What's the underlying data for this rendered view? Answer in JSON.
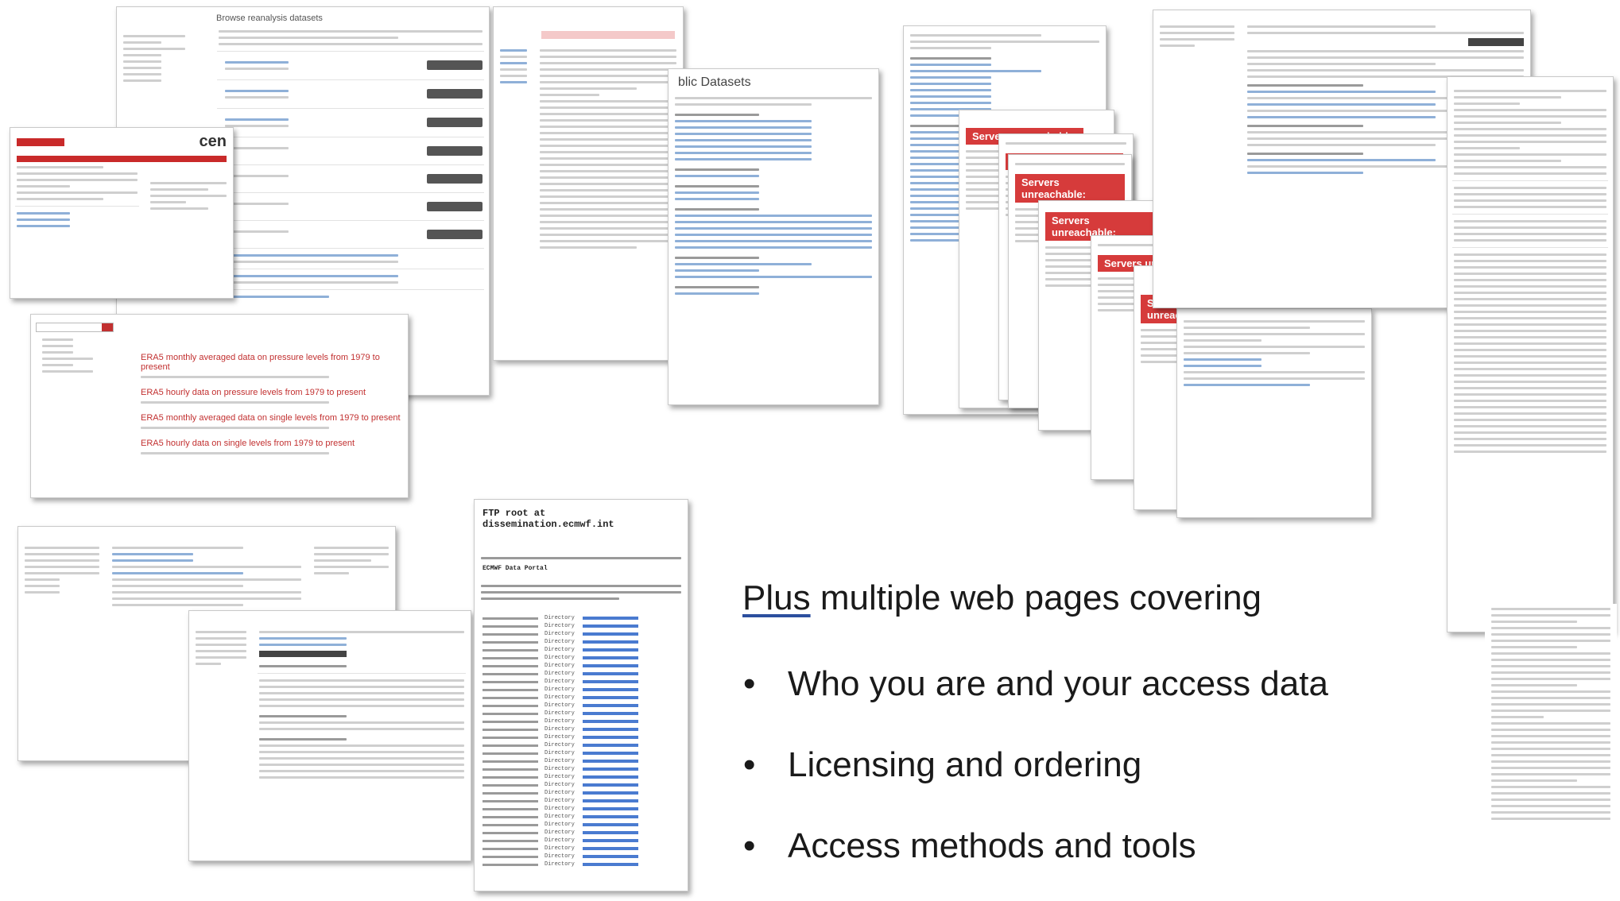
{
  "headline": {
    "underlined": "Plus",
    "rest": " multiple web pages covering"
  },
  "bullets": [
    "Who you are and your access data",
    "Licensing and ordering",
    "Access methods and tools"
  ],
  "bullet_symbol": "•",
  "thumbnails": {
    "browse_datasets_title": "Browse reanalysis datasets",
    "search_list": {
      "items": [
        "ERA5 monthly averaged data on pressure levels from 1979 to present",
        "ERA5 hourly data on pressure levels from 1979 to present",
        "ERA5 monthly averaged data on single levels from 1979 to present",
        "ERA5 hourly data on single levels from 1979 to present"
      ]
    },
    "public_datasets_title": "blic Datasets",
    "servers_unreachable": "Servers unreachable:",
    "ftp_title": "FTP root at dissemination.ecmwf.int",
    "ftp_sub": "ECMWF Data Portal",
    "ftp_dir": "Directory",
    "cen_logo": "cen"
  },
  "colors": {
    "red_banner": "#d63b3b",
    "link_blue": "#2a5db0",
    "text_dark": "#1a1a1a",
    "underline_blue": "#2c4f9e"
  }
}
